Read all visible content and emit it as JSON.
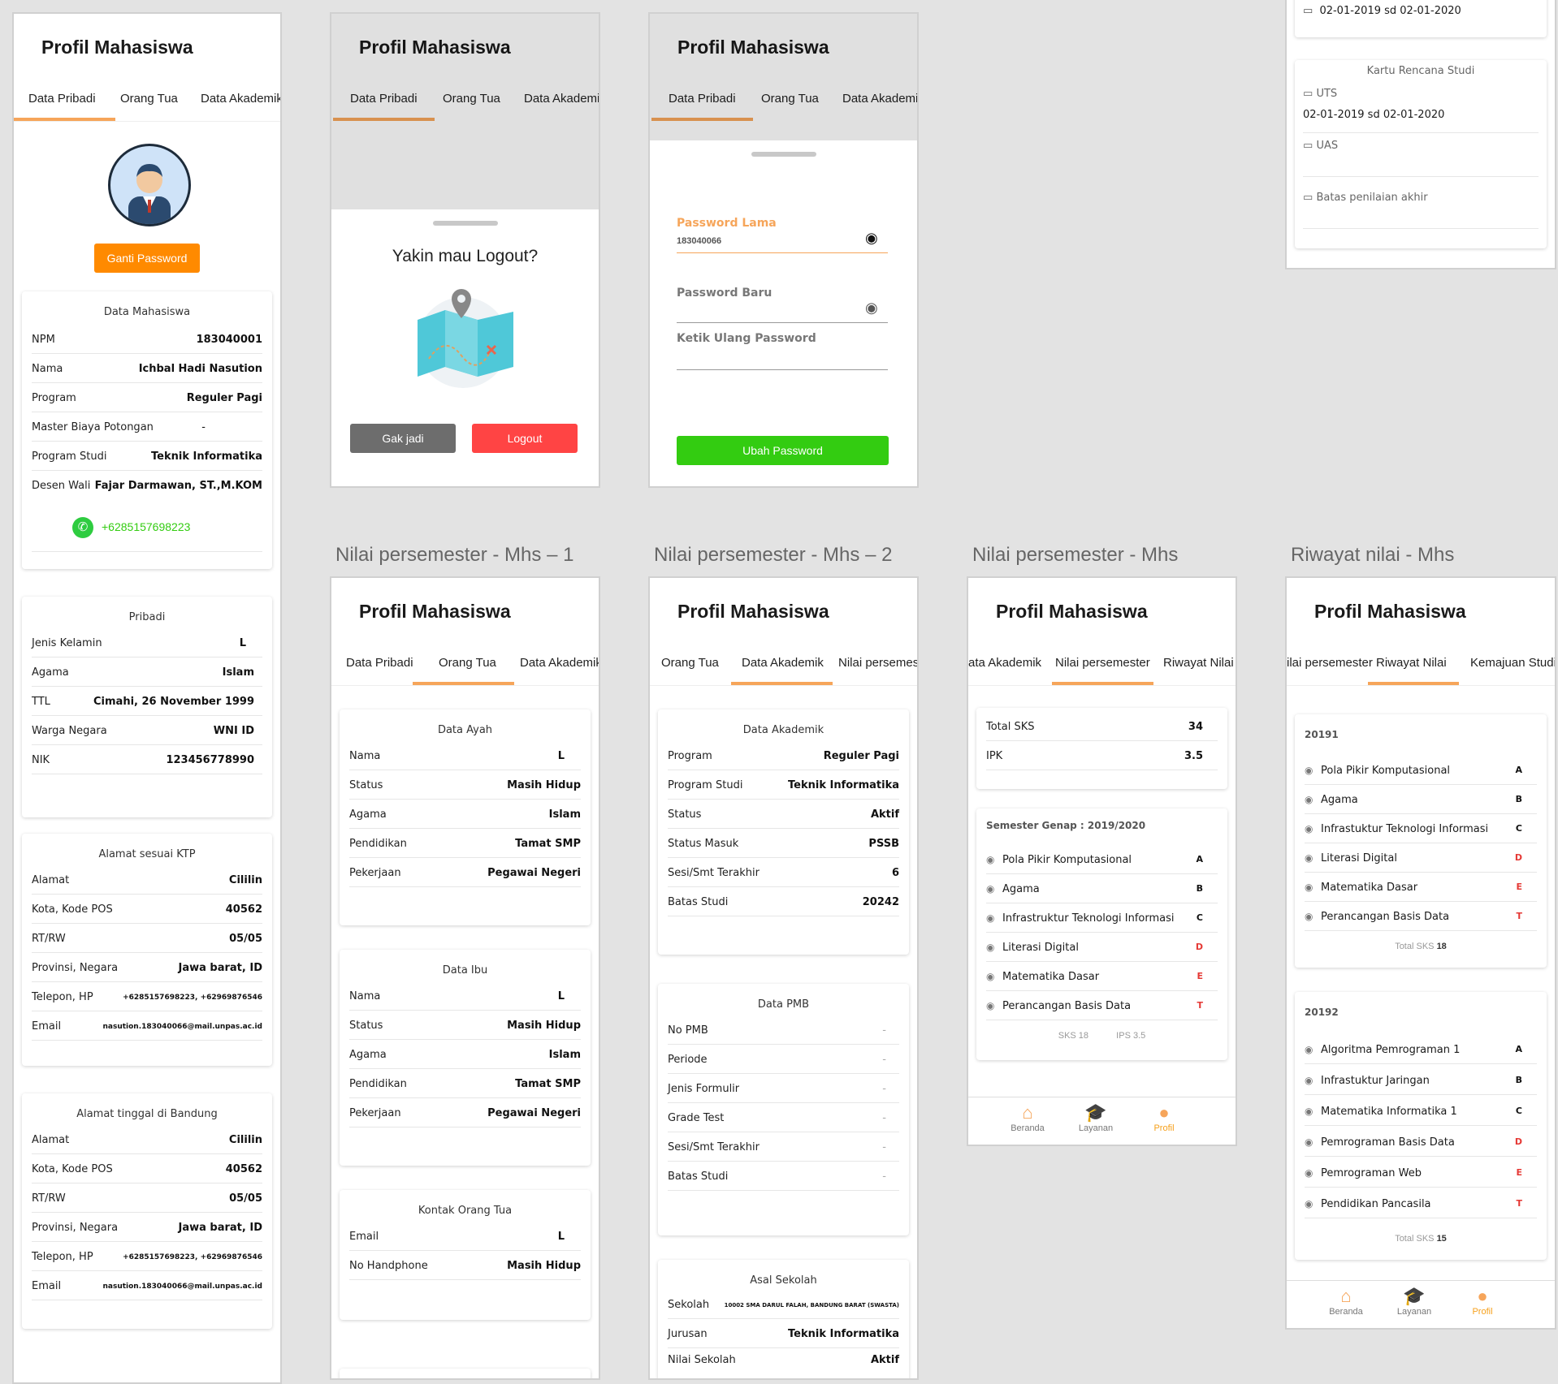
{
  "app_title": "Profil Mahasiswa",
  "tabs1": [
    "Data Pribadi",
    "Orang Tua",
    "Data Akademik"
  ],
  "tabs_nilai2": [
    "Orang Tua",
    "Data Akademik",
    "Nilai persemester"
  ],
  "tabs_nilai": [
    "ata Akademik",
    "Nilai persemester",
    "Riwayat Nilai"
  ],
  "tabs_riwayat": [
    "ilai persemester",
    "Riwayat Nilai",
    "Kemajuan Studi"
  ],
  "frame_titles": {
    "f5": "Nilai persemester - Mhs – 1",
    "f6": "Nilai persemester - Mhs – 2",
    "f7": "Nilai persemester - Mhs",
    "f8": "Riwayat nilai - Mhs"
  },
  "profile": {
    "ganti_password": "Ganti Password",
    "data_mahasiswa": {
      "title": "Data Mahasiswa",
      "rows": [
        {
          "k": "NPM",
          "v": "183040001"
        },
        {
          "k": "Nama",
          "v": "Ichbal Hadi Nasution"
        },
        {
          "k": "Program",
          "v": "Reguler Pagi"
        },
        {
          "k": "Master Biaya Potongan",
          "v": "-"
        },
        {
          "k": "Program Studi",
          "v": "Teknik Informatika"
        },
        {
          "k": "Desen Wali",
          "v": "Fajar Darmawan, ST.,M.KOM"
        }
      ],
      "whatsapp": "+6285157698223"
    },
    "pribadi": {
      "title": "Pribadi",
      "rows": [
        {
          "k": "Jenis Kelamin",
          "v": "L"
        },
        {
          "k": "Agama",
          "v": "Islam"
        },
        {
          "k": "TTL",
          "v": "Cimahi, 26 November 1999"
        },
        {
          "k": "Warga Negara",
          "v": "WNI ID"
        },
        {
          "k": "NIK",
          "v": "123456778990"
        }
      ]
    },
    "alamat_ktp": {
      "title": "Alamat sesuai KTP",
      "rows": [
        {
          "k": "Alamat",
          "v": "Cililin"
        },
        {
          "k": "Kota, Kode POS",
          "v": "40562"
        },
        {
          "k": "RT/RW",
          "v": "05/05"
        },
        {
          "k": "Provinsi, Negara",
          "v": "Jawa barat, ID"
        },
        {
          "k": "Telepon, HP",
          "v": "+6285157698223, +62969876546"
        },
        {
          "k": "Email",
          "v": "nasution.183040066@mail.unpas.ac.id"
        }
      ]
    },
    "alamat_bandung": {
      "title": "Alamat tinggal di Bandung",
      "rows": [
        {
          "k": "Alamat",
          "v": "Cililin"
        },
        {
          "k": "Kota, Kode POS",
          "v": "40562"
        },
        {
          "k": "RT/RW",
          "v": "05/05"
        },
        {
          "k": "Provinsi, Negara",
          "v": "Jawa barat, ID"
        },
        {
          "k": "Telepon, HP",
          "v": "+6285157698223, +62969876546"
        },
        {
          "k": "Email",
          "v": "nasution.183040066@mail.unpas.ac.id"
        }
      ]
    }
  },
  "logout": {
    "question": "Yakin mau Logout?",
    "cancel": "Gak jadi",
    "confirm": "Logout"
  },
  "password": {
    "old_label": "Password Lama",
    "old_value": "183040066",
    "new_label": "Password Baru",
    "retype_label": "Ketik Ulang Password",
    "submit": "Ubah Password"
  },
  "calendar": {
    "top_value": "02-01-2019 sd 02-01-2020",
    "krs_title": "Kartu Rencana Studi",
    "uts_label": "UTS",
    "uts_value": "02-01-2019 sd 02-01-2020",
    "uas_label": "UAS",
    "batas_label": "Batas penilaian akhir"
  },
  "orang_tua": {
    "ayah": {
      "title": "Data Ayah",
      "rows": [
        {
          "k": "Nama",
          "v": "L"
        },
        {
          "k": "Status",
          "v": "Masih Hidup"
        },
        {
          "k": "Agama",
          "v": "Islam"
        },
        {
          "k": "Pendidikan",
          "v": "Tamat SMP"
        },
        {
          "k": "Pekerjaan",
          "v": "Pegawai Negeri"
        }
      ]
    },
    "ibu": {
      "title": "Data Ibu",
      "rows": [
        {
          "k": "Nama",
          "v": "L"
        },
        {
          "k": "Status",
          "v": "Masih Hidup"
        },
        {
          "k": "Agama",
          "v": "Islam"
        },
        {
          "k": "Pendidikan",
          "v": "Tamat SMP"
        },
        {
          "k": "Pekerjaan",
          "v": "Pegawai Negeri"
        }
      ]
    },
    "kontak": {
      "title": "Kontak Orang Tua",
      "rows": [
        {
          "k": "Email",
          "v": "L"
        },
        {
          "k": "No Handphone",
          "v": "Masih Hidup"
        }
      ]
    }
  },
  "akademik": {
    "data": {
      "title": "Data Akademik",
      "rows": [
        {
          "k": "Program",
          "v": "Reguler Pagi"
        },
        {
          "k": "Program Studi",
          "v": "Teknik Informatika"
        },
        {
          "k": "Status",
          "v": "Aktif"
        },
        {
          "k": "Status Masuk",
          "v": "PSSB"
        },
        {
          "k": "Sesi/Smt Terakhir",
          "v": "6"
        },
        {
          "k": "Batas Studi",
          "v": "20242"
        }
      ]
    },
    "pmb": {
      "title": "Data PMB",
      "rows": [
        {
          "k": "No PMB",
          "v": "-"
        },
        {
          "k": "Periode",
          "v": "-"
        },
        {
          "k": "Jenis Formulir",
          "v": "-"
        },
        {
          "k": "Grade Test",
          "v": "-"
        },
        {
          "k": "Sesi/Smt Terakhir",
          "v": "-"
        },
        {
          "k": "Batas Studi",
          "v": "-"
        }
      ]
    },
    "sekolah": {
      "title": "Asal Sekolah",
      "rows": [
        {
          "k": "Sekolah",
          "v": "10002 SMA DARUL FALAH, BANDUNG BARAT (SWASTA)"
        },
        {
          "k": "Jurusan",
          "v": "Teknik Informatika"
        },
        {
          "k": "Nilai Sekolah",
          "v": "Aktif"
        }
      ]
    }
  },
  "nilai": {
    "summary": [
      {
        "k": "Total SKS",
        "v": "34"
      },
      {
        "k": "IPK",
        "v": "3.5"
      }
    ],
    "semester_title": "Semester Genap : 2019/2020",
    "courses": [
      {
        "name": "Pola Pikir Komputasional",
        "grade": "A",
        "color": "#111111"
      },
      {
        "name": "Agama",
        "grade": "B",
        "color": "#111111"
      },
      {
        "name": "Infrastruktur Teknologi Informasi",
        "grade": "C",
        "color": "#111111"
      },
      {
        "name": "Literasi Digital",
        "grade": "D",
        "color": "#e53935"
      },
      {
        "name": "Matematika Dasar",
        "grade": "E",
        "color": "#e53935"
      },
      {
        "name": "Perancangan Basis Data",
        "grade": "T",
        "color": "#e53935"
      }
    ],
    "sks": "SKS 18",
    "ips": "IPS 3.5"
  },
  "riwayat": {
    "s1": {
      "title": "20191",
      "courses": [
        {
          "name": "Pola Pikir Komputasional",
          "grade": "A",
          "color": "#111111"
        },
        {
          "name": "Agama",
          "grade": "B",
          "color": "#111111"
        },
        {
          "name": "Infrastuktur Teknologi Informasi",
          "grade": "C",
          "color": "#111111"
        },
        {
          "name": "Literasi Digital",
          "grade": "D",
          "color": "#e53935"
        },
        {
          "name": "Matematika Dasar",
          "grade": "E",
          "color": "#e53935"
        },
        {
          "name": "Perancangan Basis Data",
          "grade": "T",
          "color": "#e53935"
        }
      ],
      "total_label": "Total SKS",
      "total_value": "18"
    },
    "s2": {
      "title": "20192",
      "courses": [
        {
          "name": "Algoritma Pemrograman 1",
          "grade": "A",
          "color": "#111111"
        },
        {
          "name": "Infrastuktur Jaringan",
          "grade": "B",
          "color": "#111111"
        },
        {
          "name": "Matematika Informatika 1",
          "grade": "C",
          "color": "#111111"
        },
        {
          "name": "Pemrograman Basis Data",
          "grade": "D",
          "color": "#e53935"
        },
        {
          "name": "Pemrograman Web",
          "grade": "E",
          "color": "#e53935"
        },
        {
          "name": "Pendidikan Pancasila",
          "grade": "T",
          "color": "#e53935"
        }
      ],
      "total_label": "Total SKS",
      "total_value": "15"
    }
  },
  "nav": [
    "Beranda",
    "Layanan",
    "Profil"
  ],
  "colors": {
    "accent": "#f6a55a",
    "orange_button": "#ff8a00",
    "green": "#33cc11",
    "red": "#f44"
  }
}
